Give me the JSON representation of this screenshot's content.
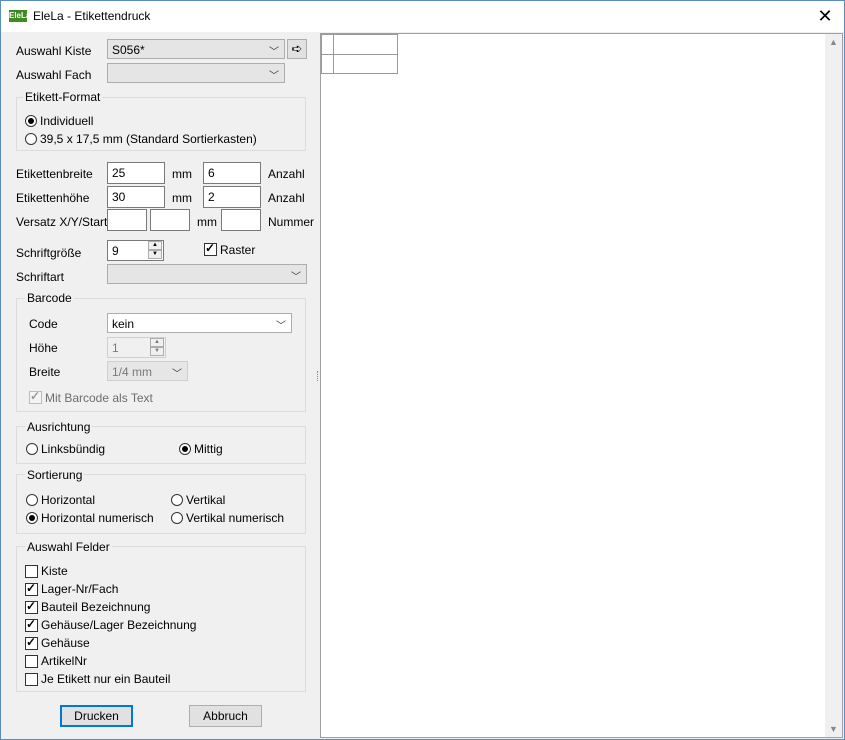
{
  "window": {
    "title": "EleLa - Etikettendruck",
    "icon_text": "EleLa",
    "close_glyph": "✕"
  },
  "kiste": {
    "label": "Auswahl Kiste",
    "value": "S056*",
    "go_glyph": "➪"
  },
  "fach": {
    "label": "Auswahl Fach",
    "value": ""
  },
  "format": {
    "title": "Etikett-Format",
    "options": [
      {
        "label": "Individuell",
        "selected": true
      },
      {
        "label": "39,5 x 17,5 mm (Standard Sortierkasten)",
        "selected": false
      }
    ]
  },
  "dims": {
    "breite_label": "Etikettenbreite",
    "breite_value": "25",
    "breite_unit": "mm",
    "breite_count": "6",
    "breite_count_label": "Anzahl",
    "hoehe_label": "Etikettenhöhe",
    "hoehe_value": "30",
    "hoehe_unit": "mm",
    "hoehe_count": "2",
    "hoehe_count_label": "Anzahl",
    "versatz_label": "Versatz X/Y/Start",
    "versatz_x": "",
    "versatz_y": "",
    "versatz_unit": "mm",
    "versatz_start": "",
    "versatz_start_label": "Nummer"
  },
  "font": {
    "size_label": "Schriftgröße",
    "size_value": "9",
    "raster_label": "Raster",
    "raster_checked": true,
    "type_label": "Schriftart",
    "type_value": ""
  },
  "barcode": {
    "title": "Barcode",
    "code_label": "Code",
    "code_value": "kein",
    "height_label": "Höhe",
    "height_value": "1",
    "width_label": "Breite",
    "width_value": "1/4 mm",
    "as_text_label": "Mit Barcode als Text",
    "as_text_checked": true
  },
  "alignment": {
    "title": "Ausrichtung",
    "options": [
      {
        "label": "Linksbündig",
        "selected": false
      },
      {
        "label": "Mittig",
        "selected": true
      }
    ]
  },
  "sorting": {
    "title": "Sortierung",
    "options": [
      {
        "label": "Horizontal",
        "selected": false
      },
      {
        "label": "Vertikal",
        "selected": false
      },
      {
        "label": "Horizontal numerisch",
        "selected": true
      },
      {
        "label": "Vertikal numerisch",
        "selected": false
      }
    ]
  },
  "fields": {
    "title": "Auswahl Felder",
    "items": [
      {
        "label": "Kiste",
        "checked": false
      },
      {
        "label": "Lager-Nr/Fach",
        "checked": true
      },
      {
        "label": "Bauteil Bezeichnung",
        "checked": true
      },
      {
        "label": "Gehäuse/Lager Bezeichnung",
        "checked": true
      },
      {
        "label": "Gehäuse",
        "checked": true
      },
      {
        "label": "ArtikelNr",
        "checked": false
      },
      {
        "label": "Je Etikett nur ein Bauteil",
        "checked": false
      }
    ]
  },
  "buttons": {
    "print": "Drucken",
    "cancel": "Abbruch"
  },
  "scrollbar": {
    "up_glyph": "▲",
    "down_glyph": "▼"
  },
  "colors": {
    "accent": "#0078d7",
    "border": "#5a8dbb",
    "icon_green": "#3d8b1f"
  }
}
